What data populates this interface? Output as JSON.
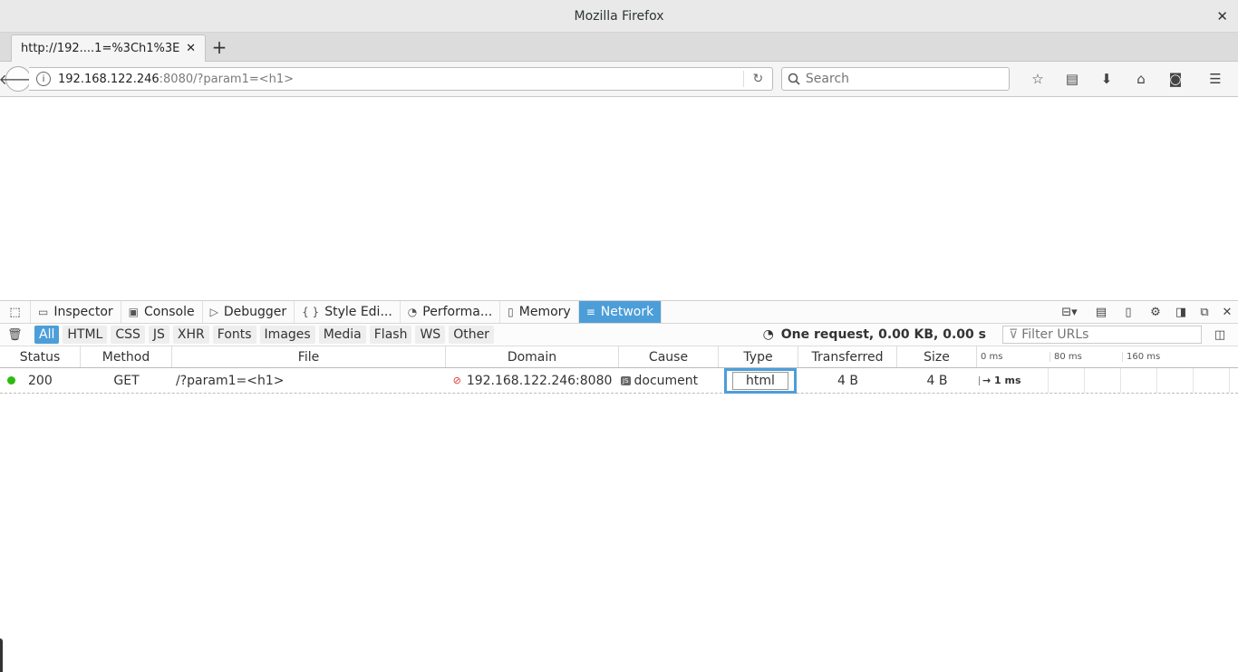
{
  "window": {
    "title": "Mozilla Firefox"
  },
  "tab": {
    "label": "http://192....1=%3Ch1%3E",
    "close": "✕",
    "new": "+"
  },
  "nav": {
    "url_host": "192.168.122.246",
    "url_rest": ":8080/?param1=<h1>",
    "search_placeholder": "Search"
  },
  "devtools": {
    "tabs": [
      {
        "label": "Inspector",
        "icon": "inspector-icon"
      },
      {
        "label": "Console",
        "icon": "console-icon"
      },
      {
        "label": "Debugger",
        "icon": "debugger-icon"
      },
      {
        "label": "Style Edi...",
        "icon": "style-editor-icon"
      },
      {
        "label": "Performa...",
        "icon": "performance-icon"
      },
      {
        "label": "Memory",
        "icon": "memory-icon"
      },
      {
        "label": "Network",
        "icon": "network-icon",
        "active": true
      }
    ],
    "filters": [
      "All",
      "HTML",
      "CSS",
      "JS",
      "XHR",
      "Fonts",
      "Images",
      "Media",
      "Flash",
      "WS",
      "Other"
    ],
    "active_filter": "All",
    "summary": "One request, 0.00 KB, 0.00 s",
    "filter_urls_placeholder": "Filter URLs",
    "columns": {
      "status": "Status",
      "method": "Method",
      "file": "File",
      "domain": "Domain",
      "cause": "Cause",
      "type": "Type",
      "transferred": "Transferred",
      "size": "Size",
      "wf0": "0 ms",
      "wf80": "80 ms",
      "wf160": "160 ms"
    },
    "requests": [
      {
        "status": "200",
        "method": "GET",
        "file": "/?param1=<h1>",
        "domain": "192.168.122.246:8080",
        "cause": "document",
        "type": "html",
        "transferred": "4 B",
        "size": "4 B",
        "timing": "→ 1 ms",
        "status_color": "#2cbb0f"
      }
    ]
  },
  "colors": {
    "accent": "#4c9ed9"
  }
}
